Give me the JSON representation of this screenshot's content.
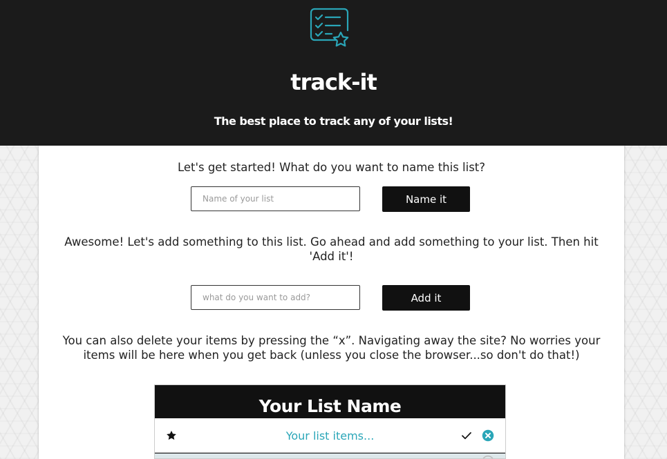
{
  "header": {
    "logo_icon": "checklist-star-icon",
    "title": "track-it",
    "tagline": "The best place to track any of your lists!"
  },
  "name_section": {
    "prompt": "Let's get started! What do you want to name this list?",
    "input_placeholder": "Name of your list",
    "input_value": "",
    "button_label": "Name it"
  },
  "add_section": {
    "prompt": "Awesome! Let's add something to this list. Go ahead and add something to your list. Then hit 'Add it'!",
    "input_placeholder": "what do you want to add?",
    "input_value": "",
    "button_label": "Add it"
  },
  "info": {
    "text": "You can also delete your items by pressing the “x”. Navigating away the site? No worries your items will be here when you get back (unless you close the browser...so don't do that!)"
  },
  "list": {
    "title": "Your List Name",
    "items": [
      {
        "text": "Your list items...",
        "icons": [
          "star-icon",
          "check-icon",
          "close-circle-icon"
        ]
      }
    ]
  },
  "colors": {
    "header_bg": "#1b1b1b",
    "accent": "#2aa6b8",
    "button_bg": "#111111",
    "panel_bg": "#ffffff"
  }
}
